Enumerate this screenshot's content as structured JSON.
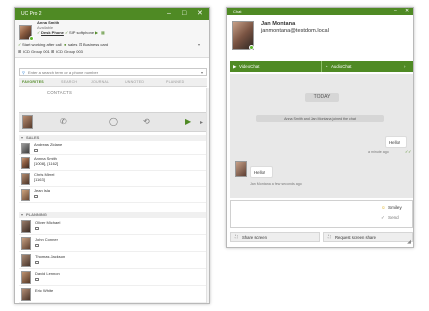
{
  "left_window": {
    "title": "UC Pro 2",
    "controls": {
      "minimize": "–",
      "maximize": "□",
      "close": "✕"
    },
    "user": {
      "name": "Anna Smith",
      "status": "Available",
      "desk_phone": "Desk Phone",
      "sip_softphone": "SIP softphone",
      "start_working": "Start working after call",
      "sales": "sales",
      "business_card": "Business card",
      "group1": "ICD Group 001",
      "group2": "ICD Group 003"
    },
    "search_placeholder": "Enter a search term or a phone number",
    "tabs": [
      "FAVORITES",
      "SEARCH",
      "JOURNAL",
      "UNNOTED",
      "PLANNED"
    ],
    "contacts_header": "CONTACTS",
    "groups": [
      {
        "name": "SALES",
        "contacts": [
          {
            "name": "Andreas Zidane",
            "detail": ""
          },
          {
            "name": "Annna Smith",
            "detail": "[1008], [1162]"
          },
          {
            "name": "Chris Mirrel",
            "detail": "[1163]"
          },
          {
            "name": "Jean Isla",
            "detail": ""
          }
        ]
      },
      {
        "name": "PLANNING",
        "contacts": [
          {
            "name": "Oliver Michael",
            "detail": ""
          },
          {
            "name": "John Conner",
            "detail": ""
          },
          {
            "name": "Thomas Jackson",
            "detail": ""
          },
          {
            "name": "David Lennon",
            "detail": ""
          },
          {
            "name": "Eric White",
            "detail": ""
          }
        ]
      }
    ]
  },
  "chat_window": {
    "title": "Chat",
    "controls": {
      "minimize": "–",
      "close": "✕"
    },
    "contact_name": "Jan Montana",
    "contact_address": "janmontana@testdom.local",
    "video_chat": "VideoChat",
    "audio_chat": "AudioChat",
    "date_label": "TODAY",
    "join_notice": "Anna Smith and Jan Montana joined the chat",
    "messages": [
      {
        "text": "Hello!",
        "meta": "a minute ago"
      },
      {
        "text": "Hello!",
        "meta": "Jan Montana   a few seconds ago"
      }
    ],
    "smiley": "Smiley",
    "send": "Send",
    "share_screen": "Share screen",
    "request_share": "Request screen share"
  },
  "colors": {
    "accent": "#4f8a24",
    "status_green": "#5cb82a",
    "chat_bg": "#e8e8e8"
  }
}
